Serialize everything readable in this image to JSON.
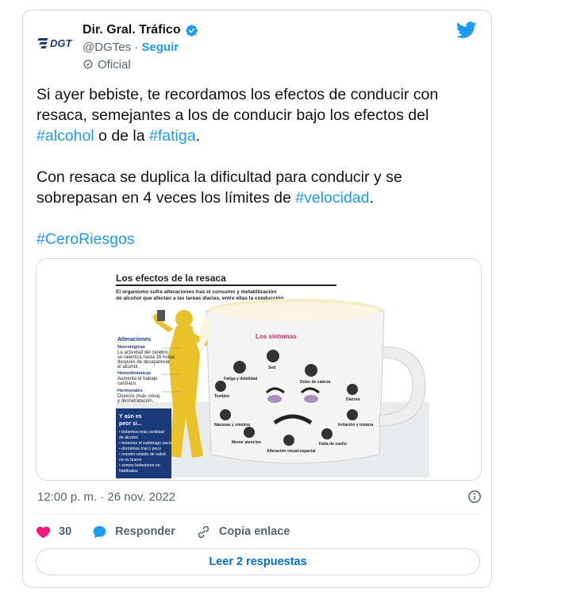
{
  "account": {
    "name": "Dir. Gral. Tráfico",
    "handle": "@DGTes",
    "separator": "·",
    "follow_label": "Seguir",
    "badge_label": "Oficial",
    "logo_text": "DGT"
  },
  "tweet": {
    "paragraph1": {
      "before": "Si ayer bebiste, te recordamos los efectos de conducir con resaca, semejantes a los de conducir bajo los efectos del ",
      "tag1": "#alcohol",
      "middle": " o de la ",
      "tag2": "#fatiga",
      "after": "."
    },
    "paragraph2": {
      "before": "Con resaca se duplica la dificultad para conducir y se sobrepasan en 4 veces los límites de ",
      "tag": "#velocidad",
      "after": "."
    },
    "hashtag": "#CeroRiesgos",
    "timestamp": "12:00 p. m. · 26 nov. 2022"
  },
  "infographic": {
    "title": "Los efectos de la resaca",
    "subtitle_line1": "El organismo sufre alteraciones tras el consumo y metabilización",
    "subtitle_line2": "de alcohol que afectan a las tareas diarias, entre ellas la conducción.",
    "alteraciones_title": "Alteraciones",
    "neurologicas": "Neurológicas",
    "neuro_l1": "La actividad del cerebro",
    "neuro_l2": "se ralentiza hasta 16 horas",
    "neuro_l3": "después de desaparecer",
    "neuro_l4": "el alcohol.",
    "hemodinamicas": "Hemodinámicas",
    "hemo_l1": "Aumenta el trabajo",
    "hemo_l2": "cardíaco.",
    "hormonales": "Hormonales",
    "horm_l1": "Diuresis (más orina)",
    "horm_l2": "y deshidratación.",
    "peor_title1": "Y aún es",
    "peor_title2": "peor si...",
    "peor_items": [
      "• bebemos más cantidad",
      "  de alcohol",
      "• tenemos el estómago vacío",
      "• dormimos mal o poco",
      "• nuestro estado de salud",
      "  no es bueno",
      "• somos bebedores no",
      "  habituales"
    ],
    "sintomas_title": "Los síntomas",
    "sintomas": {
      "sed": "Sed",
      "fatiga": "Fatiga y debilidad",
      "dolor": "Dolor de cabeza",
      "temblor": "Temblor",
      "diarrea": "Diarrea",
      "nauseas": "Náuseas y vómitos",
      "irritacion": "Irritación y tristeza",
      "atencion": "Menor atención",
      "sueno": "Falta de sueño",
      "vision": "Alteración visual-espacial"
    }
  },
  "actions": {
    "likes": "30",
    "reply_label": "Responder",
    "copy_label": "Copia enlace",
    "read_replies": "Leer 2 respuestas"
  },
  "colors": {
    "accent": "#1d9bf0",
    "like": "#f91880",
    "text": "#0f1419",
    "muted": "#536471",
    "navy": "#1b3a7a",
    "yellow": "#e9c22a"
  },
  "icons": [
    "dgt-logo-icon",
    "verified-badge-icon",
    "official-badge-icon",
    "twitter-bird-icon",
    "info-icon",
    "heart-icon",
    "reply-bubble-icon",
    "link-icon"
  ]
}
